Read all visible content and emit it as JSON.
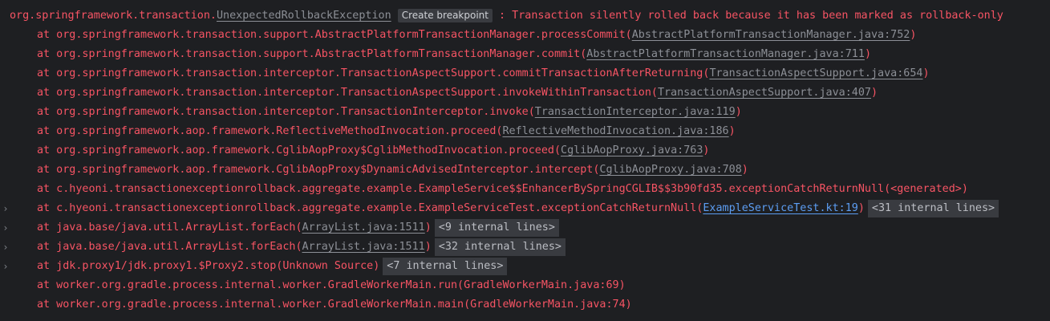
{
  "header": {
    "prefix": "org.springframework.transaction.",
    "exception_class": "UnexpectedRollbackException",
    "breakpoint_label": "Create breakpoint",
    "message": " : Transaction silently rolled back because it has been marked as rollback-only"
  },
  "frames": [
    {
      "text": "at org.springframework.transaction.support.AbstractPlatformTransactionManager.processCommit(",
      "link": "AbstractPlatformTransactionManager.java:752",
      "suffix": ")"
    },
    {
      "text": "at org.springframework.transaction.support.AbstractPlatformTransactionManager.commit(",
      "link": "AbstractPlatformTransactionManager.java:711",
      "suffix": ")"
    },
    {
      "text": "at org.springframework.transaction.interceptor.TransactionAspectSupport.commitTransactionAfterReturning(",
      "link": "TransactionAspectSupport.java:654",
      "suffix": ")"
    },
    {
      "text": "at org.springframework.transaction.interceptor.TransactionAspectSupport.invokeWithinTransaction(",
      "link": "TransactionAspectSupport.java:407",
      "suffix": ")"
    },
    {
      "text": "at org.springframework.transaction.interceptor.TransactionInterceptor.invoke(",
      "link": "TransactionInterceptor.java:119",
      "suffix": ")"
    },
    {
      "text": "at org.springframework.aop.framework.ReflectiveMethodInvocation.proceed(",
      "link": "ReflectiveMethodInvocation.java:186",
      "suffix": ")"
    },
    {
      "text": "at org.springframework.aop.framework.CglibAopProxy$CglibMethodInvocation.proceed(",
      "link": "CglibAopProxy.java:763",
      "suffix": ")"
    },
    {
      "text": "at org.springframework.aop.framework.CglibAopProxy$DynamicAdvisedInterceptor.intercept(",
      "link": "CglibAopProxy.java:708",
      "suffix": ")"
    },
    {
      "text": "at c.hyeoni.transactionexceptionrollback.aggregate.example.ExampleService$$EnhancerBySpringCGLIB$$3b90fd35.exceptionCatchReturnNull(<generated>)"
    },
    {
      "text": "at c.hyeoni.transactionexceptionrollback.aggregate.example.ExampleServiceTest.exceptionCatchReturnNull(",
      "link": "ExampleServiceTest.kt:19",
      "suffix": ")",
      "user_link": true,
      "badge": "<31 internal lines>",
      "expandable": true
    },
    {
      "text": "at java.base/java.util.ArrayList.forEach(",
      "link": "ArrayList.java:1511",
      "suffix": ")",
      "badge": "<9 internal lines>",
      "expandable": true
    },
    {
      "text": "at java.base/java.util.ArrayList.forEach(",
      "link": "ArrayList.java:1511",
      "suffix": ")",
      "badge": "<32 internal lines>",
      "expandable": true
    },
    {
      "text": "at jdk.proxy1/jdk.proxy1.$Proxy2.stop(Unknown Source)",
      "badge": "<7 internal lines>",
      "expandable": true
    },
    {
      "text": "at worker.org.gradle.process.internal.worker.GradleWorkerMain.run(GradleWorkerMain.java:69)"
    },
    {
      "text": "at worker.org.gradle.process.internal.worker.GradleWorkerMain.main(GradleWorkerMain.java:74)"
    }
  ],
  "icons": {
    "expand": "chevron-right-icon"
  },
  "colors": {
    "background": "#1e1f22",
    "error_text": "#f75464",
    "link": "#8c8f96",
    "user_link": "#5c9df2",
    "badge_bg": "#393b40"
  }
}
